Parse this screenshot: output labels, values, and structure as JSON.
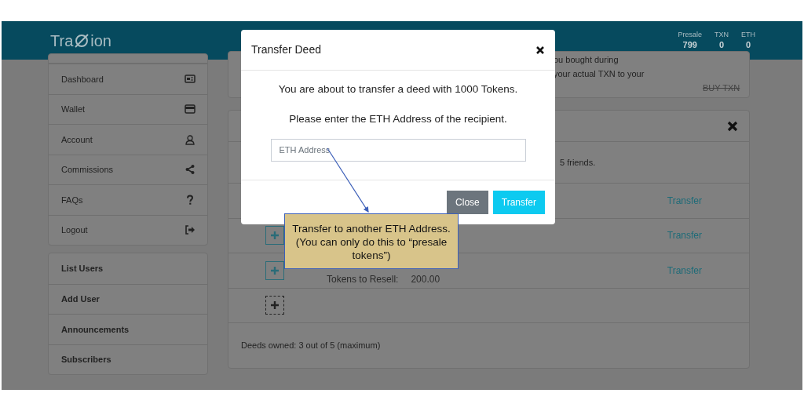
{
  "header": {
    "logo_start": "Tra",
    "logo_end": "ion",
    "stats": [
      {
        "label": "Presale",
        "value": "799"
      },
      {
        "label": "TXN",
        "value": "0"
      },
      {
        "label": "ETH",
        "value": "0"
      }
    ]
  },
  "sidebar": {
    "nav": [
      {
        "label": "Dashboard"
      },
      {
        "label": "Wallet"
      },
      {
        "label": "Account"
      },
      {
        "label": "Commissions"
      },
      {
        "label": "FAQs"
      },
      {
        "label": "Logout"
      }
    ],
    "admin": [
      {
        "label": "List Users"
      },
      {
        "label": "Add User"
      },
      {
        "label": "Announcements"
      },
      {
        "label": "Subscribers"
      }
    ]
  },
  "top_card": {
    "lines": [
      "ou bought during",
      "your actual TXN to your"
    ],
    "button": "BUY TXN"
  },
  "deeds_card": {
    "info": "5 friends.",
    "rows": [
      {
        "kind": "deed",
        "link": "Transfer"
      },
      {
        "kind": "deed",
        "link": "Transfer"
      },
      {
        "kind": "deed",
        "label": "Tokens to Resell:",
        "amount": "200.00",
        "link": "Transfer"
      },
      {
        "kind": "add"
      }
    ],
    "footer": "Deeds owned: 3 out of 5 (maximum)"
  },
  "modal": {
    "title": "Transfer Deed",
    "lines": [
      "You are about to transfer a deed with 1000 Tokens.",
      "Please enter the ETH Address of the recipient."
    ],
    "input": {
      "placeholder": "ETH Address"
    },
    "buttons": [
      {
        "label": "Close",
        "kind": "secondary"
      },
      {
        "label": "Transfer",
        "kind": "primary"
      }
    ]
  },
  "callout": {
    "text": "Transfer to another ETH Address. (You can only do this to “presale tokens”)"
  }
}
